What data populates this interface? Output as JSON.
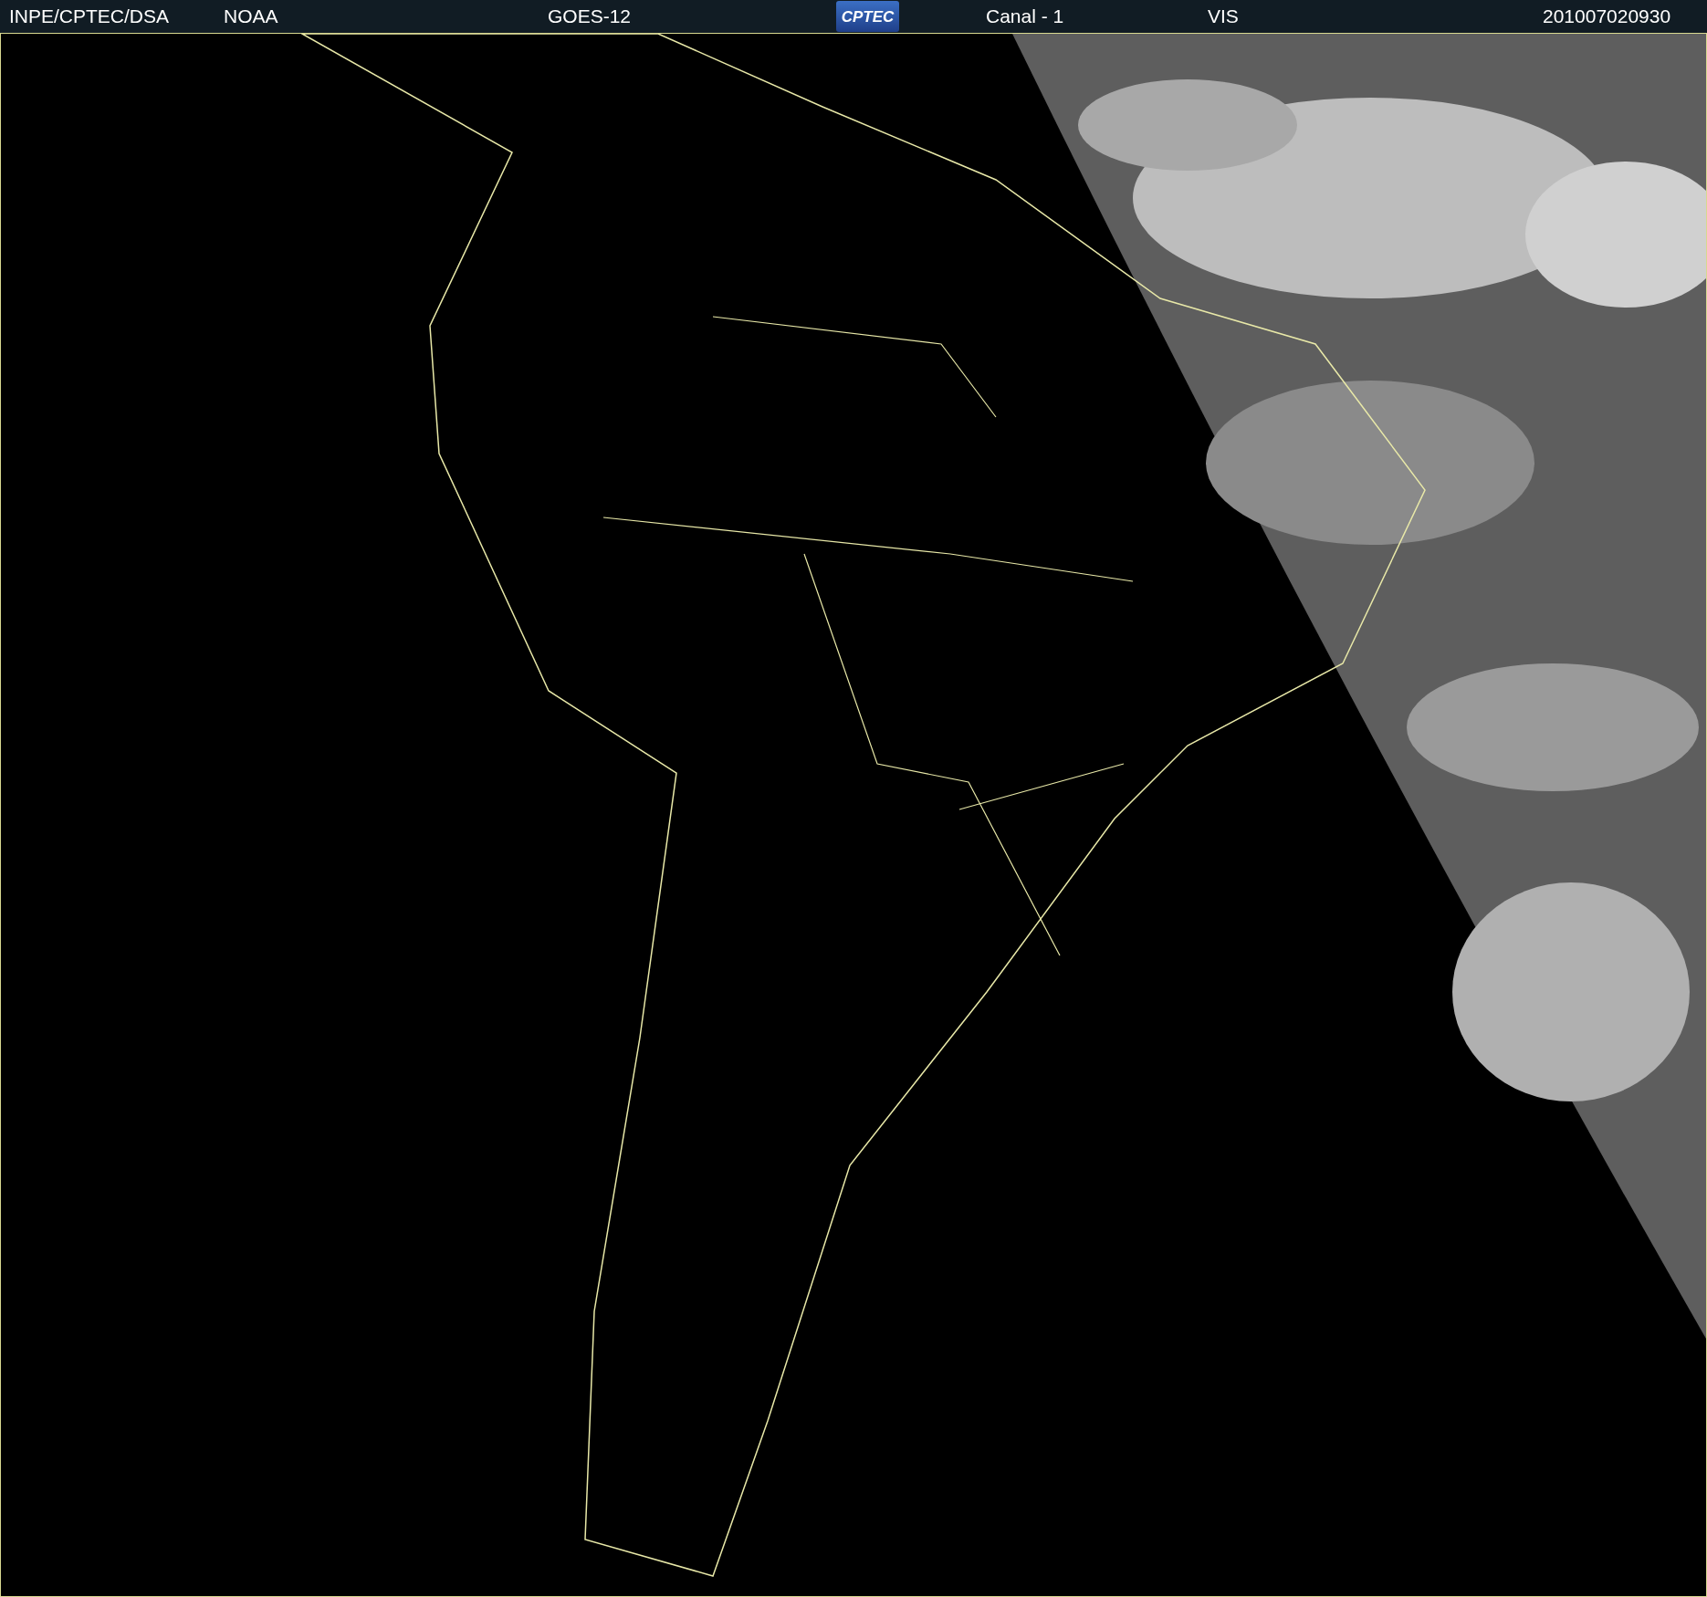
{
  "header": {
    "items": [
      {
        "kind": "text",
        "text": "INPE/CPTEC/DSA"
      },
      {
        "kind": "text",
        "text": "NOAA"
      },
      {
        "kind": "text",
        "text": "GOES-12"
      },
      {
        "kind": "logo",
        "text": "CPTEC"
      },
      {
        "kind": "text",
        "text": "Canal - 1"
      },
      {
        "kind": "text",
        "text": "VIS"
      },
      {
        "kind": "text",
        "text": "201007020930"
      }
    ]
  }
}
